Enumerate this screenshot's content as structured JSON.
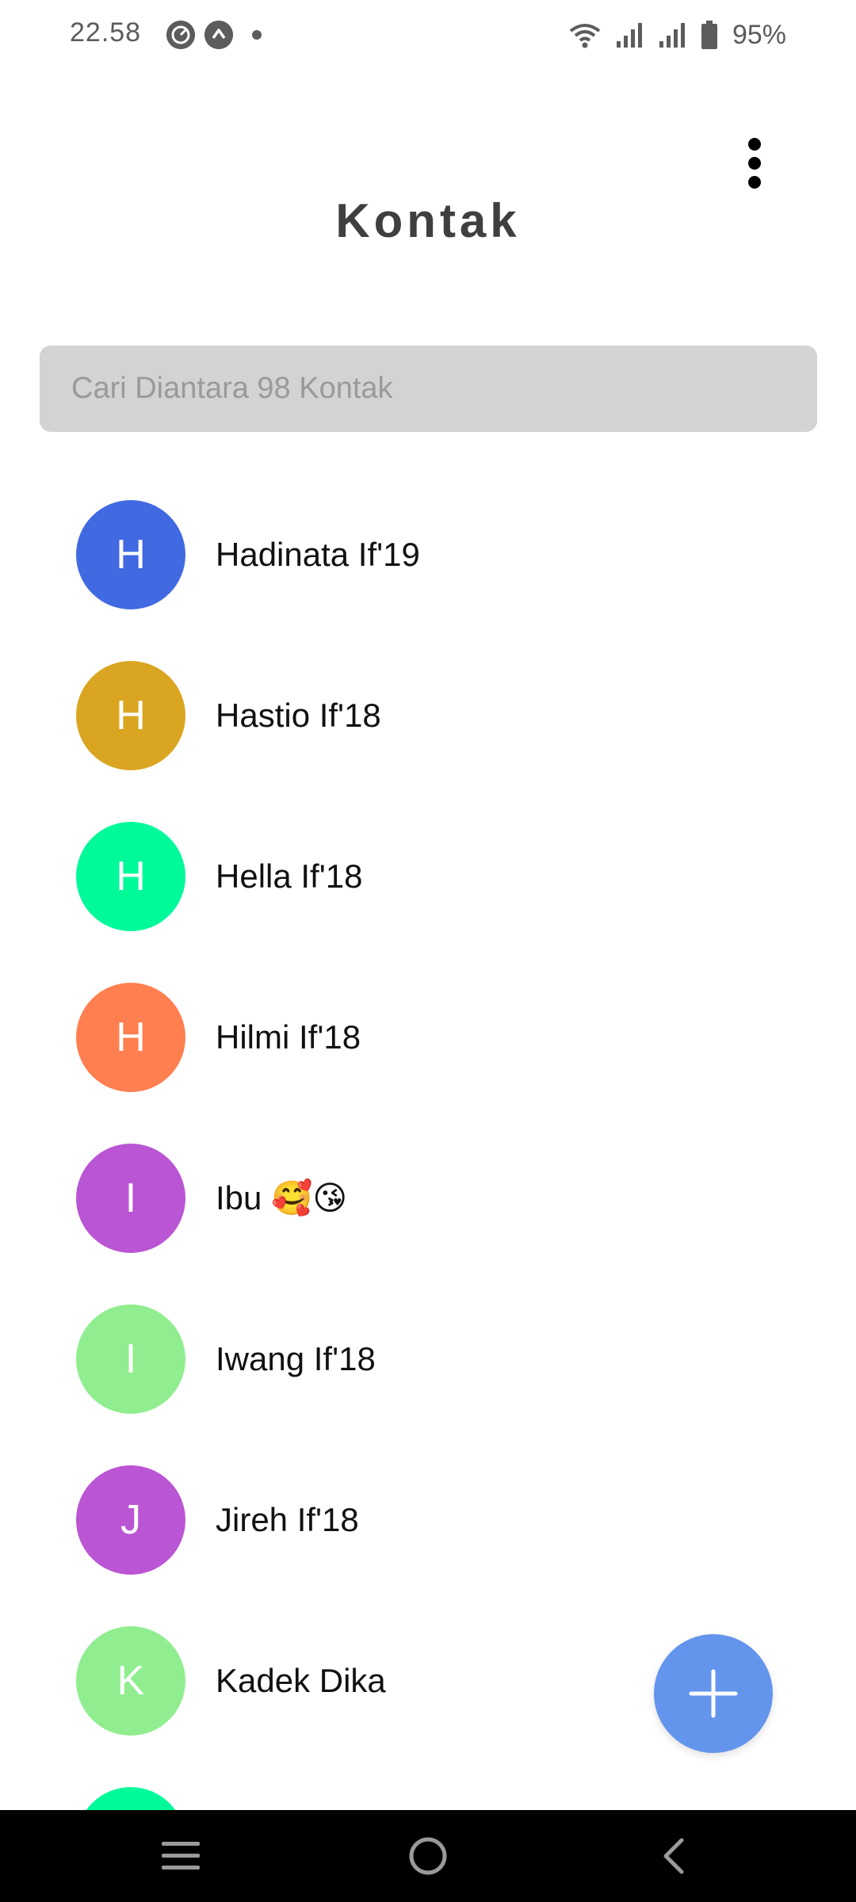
{
  "status_bar": {
    "time": "22.58",
    "notification_icons": [
      "speedometer-icon",
      "arrow-up-circle-icon"
    ],
    "battery": "95%"
  },
  "header": {
    "title": "Kontak",
    "menu_icon": "more-vertical-icon"
  },
  "search": {
    "placeholder": "Cari Diantara 98 Kontak",
    "value": ""
  },
  "contacts": [
    {
      "initial": "H",
      "name": "Hadinata If'19",
      "color": "#4169e1"
    },
    {
      "initial": "H",
      "name": "Hastio If'18",
      "color": "#daa520"
    },
    {
      "initial": "H",
      "name": "Hella If'18",
      "color": "#00fa9a"
    },
    {
      "initial": "H",
      "name": "Hilmi If'18",
      "color": "#ff7f50"
    },
    {
      "initial": "I",
      "name": "Ibu 🥰😘",
      "color": "#ba55d3"
    },
    {
      "initial": "I",
      "name": "Iwang If'18",
      "color": "#90ee90"
    },
    {
      "initial": "J",
      "name": "Jireh If'18",
      "color": "#ba55d3"
    },
    {
      "initial": "K",
      "name": "Kadek Dika",
      "color": "#90ee90"
    },
    {
      "initial": "",
      "name": "",
      "color": "#00fa9a"
    }
  ],
  "fab": {
    "icon": "plus-icon",
    "color": "#6495ed"
  },
  "nav_bar": {
    "buttons": [
      "recent-apps-icon",
      "home-icon",
      "back-icon"
    ]
  }
}
